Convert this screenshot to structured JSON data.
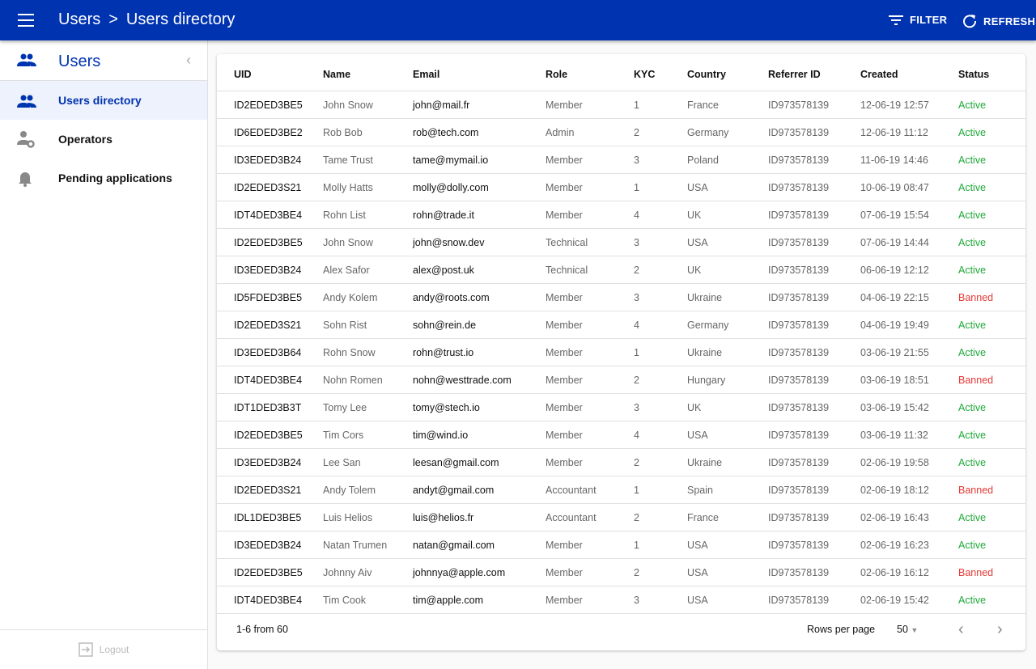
{
  "topbar": {
    "crumb_root": "Users",
    "crumb_sep": ">",
    "crumb_current": "Users directory",
    "filter": "FILTER",
    "refresh": "REFRESH"
  },
  "sidebar": {
    "title": "Users",
    "items": [
      {
        "label": "Users directory",
        "icon": "users-icon",
        "active": true
      },
      {
        "label": "Operators",
        "icon": "user-gear-icon"
      },
      {
        "label": "Pending applications",
        "icon": "bell-icon"
      }
    ],
    "logout": "Logout"
  },
  "table": {
    "columns": [
      "UID",
      "Name",
      "Email",
      "Role",
      "KYC",
      "Country",
      "Referrer ID",
      "Created",
      "Status"
    ],
    "rows": [
      [
        "ID2EDED3BE5",
        "John Snow",
        "john@mail.fr",
        "Member",
        "1",
        "France",
        "ID973578139",
        "12-06-19 12:57",
        "Active"
      ],
      [
        "ID6EDED3BE2",
        "Rob Bob",
        "rob@tech.com",
        "Admin",
        "2",
        "Germany",
        "ID973578139",
        "12-06-19 11:12",
        "Active"
      ],
      [
        "ID3EDED3B24",
        "Tame Trust",
        "tame@mymail.io",
        "Member",
        "3",
        "Poland",
        "ID973578139",
        "11-06-19 14:46",
        "Active"
      ],
      [
        "ID2EDED3S21",
        "Molly Hatts",
        "molly@dolly.com",
        "Member",
        "1",
        "USA",
        "ID973578139",
        "10-06-19 08:47",
        "Active"
      ],
      [
        "IDT4DED3BE4",
        "Rohn List",
        "rohn@trade.it",
        "Member",
        "4",
        "UK",
        "ID973578139",
        "07-06-19 15:54",
        "Active"
      ],
      [
        "ID2EDED3BE5",
        "John Snow",
        "john@snow.dev",
        "Technical",
        "3",
        "USA",
        "ID973578139",
        "07-06-19 14:44",
        "Active"
      ],
      [
        "ID3EDED3B24",
        "Alex Safor",
        "alex@post.uk",
        "Technical",
        "2",
        "UK",
        "ID973578139",
        "06-06-19 12:12",
        "Active"
      ],
      [
        "ID5FDED3BE5",
        "Andy Kolem",
        "andy@roots.com",
        "Member",
        "3",
        "Ukraine",
        "ID973578139",
        "04-06-19 22:15",
        "Banned"
      ],
      [
        "ID2EDED3S21",
        "Sohn Rist",
        "sohn@rein.de",
        "Member",
        "4",
        "Germany",
        "ID973578139",
        "04-06-19 19:49",
        "Active"
      ],
      [
        "ID3EDED3B64",
        "Rohn Snow",
        "rohn@trust.io",
        "Member",
        "1",
        "Ukraine",
        "ID973578139",
        "03-06-19 21:55",
        "Active"
      ],
      [
        "IDT4DED3BE4",
        "Nohn Romen",
        "nohn@westtrade.com",
        "Member",
        "2",
        "Hungary",
        "ID973578139",
        "03-06-19 18:51",
        "Banned"
      ],
      [
        "IDT1DED3B3T",
        "Tomy Lee",
        "tomy@stech.io",
        "Member",
        "3",
        "UK",
        "ID973578139",
        "03-06-19 15:42",
        "Active"
      ],
      [
        "ID2EDED3BE5",
        "Tim Cors",
        "tim@wind.io",
        "Member",
        "4",
        "USA",
        "ID973578139",
        "03-06-19 11:32",
        "Active"
      ],
      [
        "ID3EDED3B24",
        "Lee San",
        "leesan@gmail.com",
        "Member",
        "2",
        "Ukraine",
        "ID973578139",
        "02-06-19 19:58",
        "Active"
      ],
      [
        "ID2EDED3S21",
        "Andy Tolem",
        "andyt@gmail.com",
        "Accountant",
        "1",
        "Spain",
        "ID973578139",
        "02-06-19 18:12",
        "Banned"
      ],
      [
        "IDL1DED3BE5",
        "Luis Helios",
        "luis@helios.fr",
        "Accountant",
        "2",
        "France",
        "ID973578139",
        "02-06-19 16:43",
        "Active"
      ],
      [
        "ID3EDED3B24",
        "Natan Trumen",
        "natan@gmail.com",
        "Member",
        "1",
        "USA",
        "ID973578139",
        "02-06-19 16:23",
        "Active"
      ],
      [
        "ID2EDED3BE5",
        "Johnny Aiv",
        "johnnya@apple.com",
        "Member",
        "2",
        "USA",
        "ID973578139",
        "02-06-19 16:12",
        "Banned"
      ],
      [
        "IDT4DED3BE4",
        "Tim Cook",
        "tim@apple.com",
        "Member",
        "3",
        "USA",
        "ID973578139",
        "02-06-19 15:42",
        "Active"
      ]
    ]
  },
  "footer": {
    "range": "1-6 from 60",
    "rows_per_page_label": "Rows per page",
    "rows_per_page": "50"
  },
  "colors": {
    "brand": "#0033b0",
    "active": "#1fa93a",
    "banned": "#e53935"
  }
}
